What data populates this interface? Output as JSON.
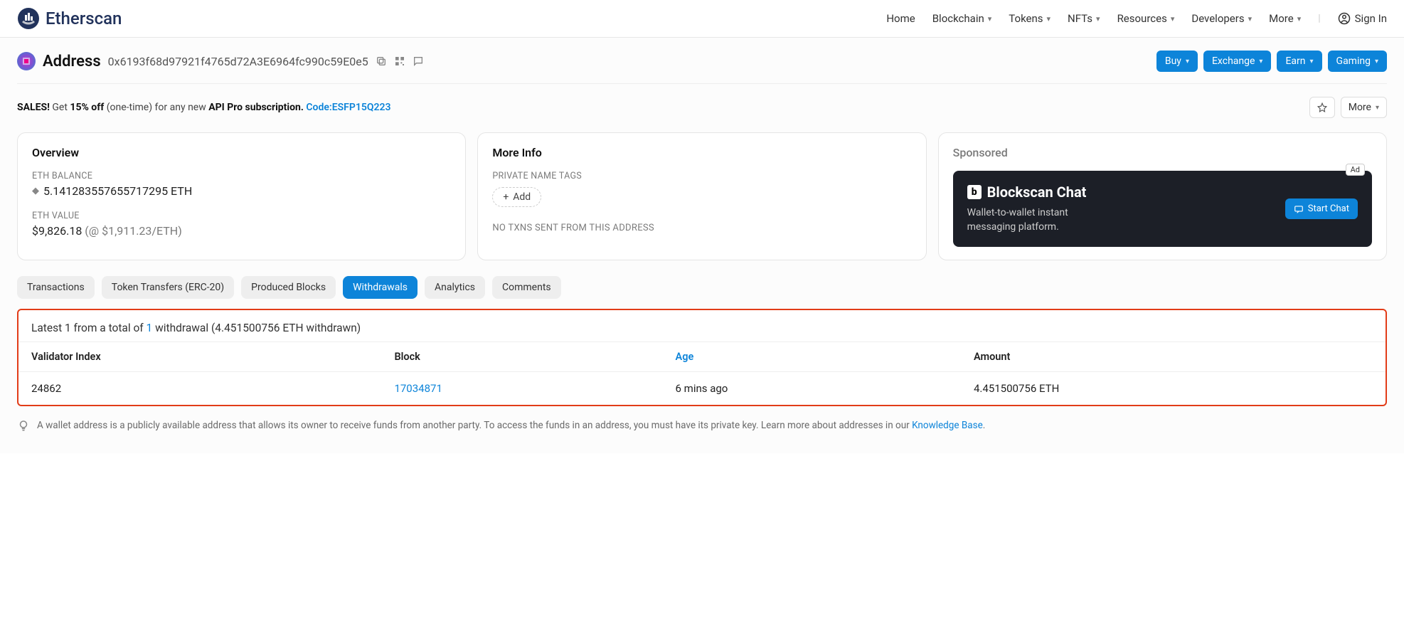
{
  "logo": {
    "text": "Etherscan"
  },
  "nav": {
    "home": "Home",
    "blockchain": "Blockchain",
    "tokens": "Tokens",
    "nfts": "NFTs",
    "resources": "Resources",
    "developers": "Developers",
    "more": "More",
    "signin": "Sign In"
  },
  "address": {
    "title": "Address",
    "hash": "0x6193f68d97921f4765d72A3E6964fc990c59E0e5"
  },
  "actionButtons": {
    "buy": "Buy",
    "exchange": "Exchange",
    "earn": "Earn",
    "gaming": "Gaming"
  },
  "sales": {
    "prefix": "SALES!",
    "get": "Get",
    "percent": "15% off",
    "middle": "(one-time) for any new",
    "bold2": "API Pro subscription.",
    "code_label": "Code:",
    "code": "ESFP15Q223",
    "more": "More"
  },
  "overview": {
    "title": "Overview",
    "balance_label": "ETH BALANCE",
    "balance": "5.141283557655717295 ETH",
    "value_label": "ETH VALUE",
    "value": "$9,826.18",
    "rate": "(@ $1,911.23/ETH)"
  },
  "moreInfo": {
    "title": "More Info",
    "tags_label": "PRIVATE NAME TAGS",
    "add": "Add",
    "no_txns": "NO TXNS SENT FROM THIS ADDRESS"
  },
  "sponsored": {
    "title": "Sponsored",
    "ad": "Ad",
    "brand": "Blockscan Chat",
    "sub1": "Wallet-to-wallet instant",
    "sub2": "messaging platform.",
    "cta": "Start Chat"
  },
  "tabs": {
    "transactions": "Transactions",
    "token_transfers": "Token Transfers (ERC-20)",
    "produced_blocks": "Produced Blocks",
    "withdrawals": "Withdrawals",
    "analytics": "Analytics",
    "comments": "Comments"
  },
  "withdrawals": {
    "caption_prefix": "Latest 1 from a total of",
    "caption_link": "1",
    "caption_suffix": "withdrawal (4.451500756 ETH withdrawn)",
    "headers": {
      "validator": "Validator Index",
      "block": "Block",
      "age": "Age",
      "amount": "Amount"
    },
    "row": {
      "validator": "24862",
      "block": "17034871",
      "age": "6 mins ago",
      "amount": "4.451500756 ETH"
    }
  },
  "footnote": {
    "text": "A wallet address is a publicly available address that allows its owner to receive funds from another party. To access the funds in an address, you must have its private key. Learn more about addresses in our",
    "link": "Knowledge Base",
    "dot": "."
  }
}
